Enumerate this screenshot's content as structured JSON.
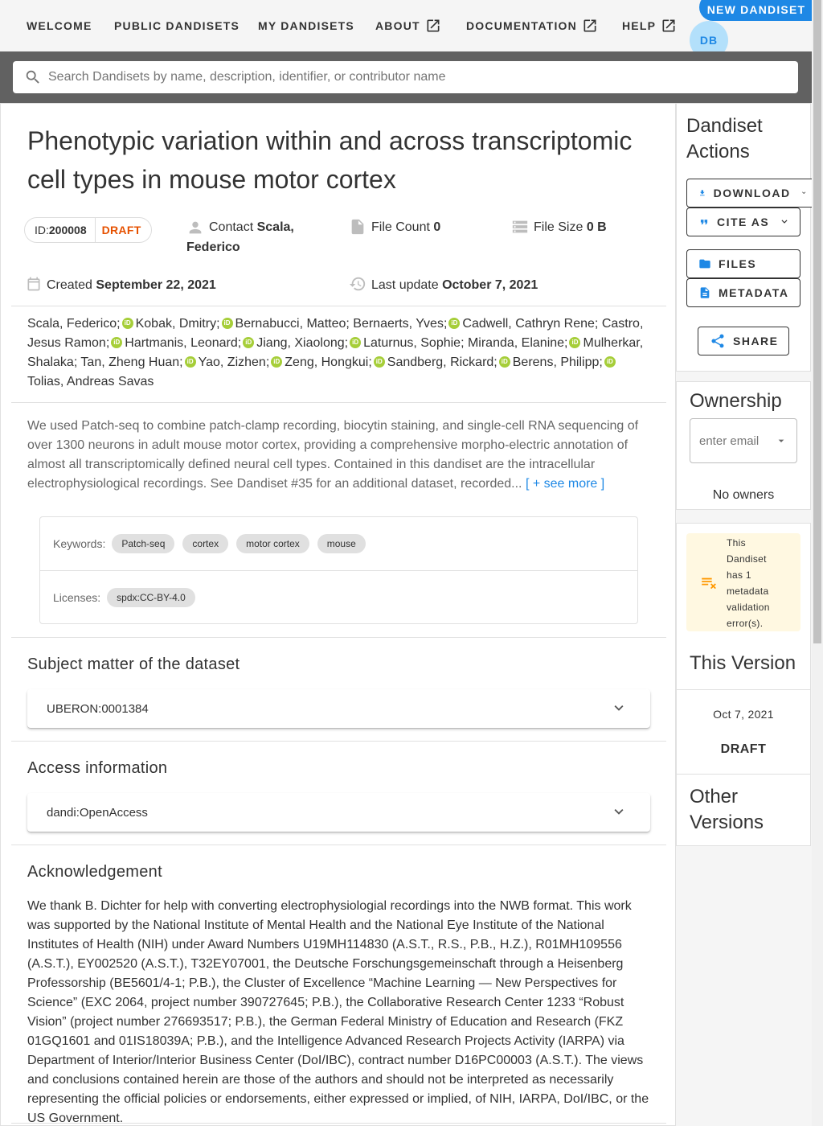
{
  "nav": {
    "welcome": "WELCOME",
    "public": "PUBLIC DANDISETS",
    "mine": "MY DANDISETS",
    "about": "ABOUT",
    "docs": "DOCUMENTATION",
    "help": "HELP",
    "new_dandiset": "NEW DANDISET",
    "avatar_initials": "DB"
  },
  "search": {
    "placeholder": "Search Dandisets by name, description, identifier, or contributor name"
  },
  "dandiset": {
    "title": "Phenotypic variation within and across transcriptomic cell types in mouse motor cortex",
    "id_label": "ID:",
    "id": "200008",
    "status": "DRAFT",
    "contact_label": "Contact",
    "contact": "Scala, Federico",
    "file_count_label": "File Count",
    "file_count": "0",
    "file_size_label": "File Size",
    "file_size": "0 B",
    "created_label": "Created",
    "created": "September 22, 2021",
    "updated_label": "Last update",
    "updated": "October 7, 2021",
    "authors": [
      {
        "name": "Scala, Federico",
        "orcid": true
      },
      {
        "name": "Kobak, Dmitry",
        "orcid": true
      },
      {
        "name": "Bernabucci, Matteo",
        "orcid": false
      },
      {
        "name": "Bernaerts, Yves",
        "orcid": true
      },
      {
        "name": "Cadwell, Cathryn Rene",
        "orcid": false
      },
      {
        "name": "Castro, Jesus Ramon",
        "orcid": true
      },
      {
        "name": "Hartmanis, Leonard",
        "orcid": true
      },
      {
        "name": "Jiang, Xiaolong",
        "orcid": true
      },
      {
        "name": "Laturnus, Sophie",
        "orcid": false
      },
      {
        "name": "Miranda, Elanine",
        "orcid": true
      },
      {
        "name": "Mulherkar, Shalaka",
        "orcid": false
      },
      {
        "name": "Tan, Zheng Huan",
        "orcid": true
      },
      {
        "name": "Yao, Zizhen",
        "orcid": true
      },
      {
        "name": "Zeng, Hongkui",
        "orcid": true
      },
      {
        "name": "Sandberg, Rickard",
        "orcid": true
      },
      {
        "name": "Berens, Philipp",
        "orcid": true
      },
      {
        "name": "Tolias, Andreas Savas",
        "orcid": false
      }
    ],
    "description": "We used Patch-seq to combine patch-clamp recording, biocytin staining, and single-cell RNA sequencing of over 1300 neurons in adult mouse motor cortex, providing a comprehensive morpho-electric annotation of almost all transcriptomically defined neural cell types. Contained in this dandiset are the intracellular electrophysiological recordings. See Dandiset #35 for an additional dataset, recorded...",
    "see_more": "[ + see more ]",
    "keywords_label": "Keywords:",
    "keywords": [
      "Patch-seq",
      "cortex",
      "motor cortex",
      "mouse"
    ],
    "licenses_label": "Licenses:",
    "licenses": [
      "spdx:CC-BY-4.0"
    ],
    "subject_title": "Subject matter of the dataset",
    "subject_item": "UBERON:0001384",
    "access_title": "Access information",
    "access_item": "dandi:OpenAccess",
    "ack_title": "Acknowledgement",
    "acknowledgement": "We thank B. Dichter for help with converting electrophysiologial recordings into the NWB format. This work was supported by the National Institute of Mental Health and the National Eye Institute of the National Institutes of Health (NIH) under Award Numbers U19MH114830 (A.S.T., R.S., P.B., H.Z.), R01MH109556 (A.S.T.), EY002520 (A.S.T.), T32EY07001, the Deutsche Forschungsgemeinschaft through a Heisenberg Professorship (BE5601/4-1; P.B.), the Cluster of Excellence “Machine Learning — New Perspectives for Science” (EXC 2064, project number 390727645; P.B.), the Collaborative Research Center 1233 “Robust Vision” (project number 276693517; P.B.), the German Federal Ministry of Education and Research (FKZ 01GQ1601 and 01IS18039A; P.B.), and the Intelligence Advanced Research Projects Activity (IARPA) via Department of Interior/Interior Business Center (DoI/IBC), contract number D16PC00003 (A.S.T.). The views and conclusions contained herein are those of the authors and should not be interpreted as necessarily representing the official policies or endorsements, either expressed or implied, of NIH, IARPA, DoI/IBC, or the US Government."
  },
  "sidebar": {
    "actions_title": "Dandiset Actions",
    "download": "DOWNLOAD",
    "cite": "CITE AS",
    "files": "FILES",
    "metadata": "METADATA",
    "share": "SHARE",
    "ownership_title": "Ownership",
    "owner_placeholder": "enter email",
    "no_owners": "No owners",
    "validation_message": "This Dandiset has 1 metadata validation error(s).",
    "this_version_title": "This Version",
    "version_date": "Oct 7, 2021",
    "version_label": "DRAFT",
    "other_versions_title": "Other Versions"
  },
  "colors": {
    "primary": "#1e88e5",
    "draft": "#e65100",
    "orcid": "#a6ce39",
    "search_band": "#616161",
    "warning_bg": "#fff8e1",
    "warning_icon": "#ff9800"
  }
}
